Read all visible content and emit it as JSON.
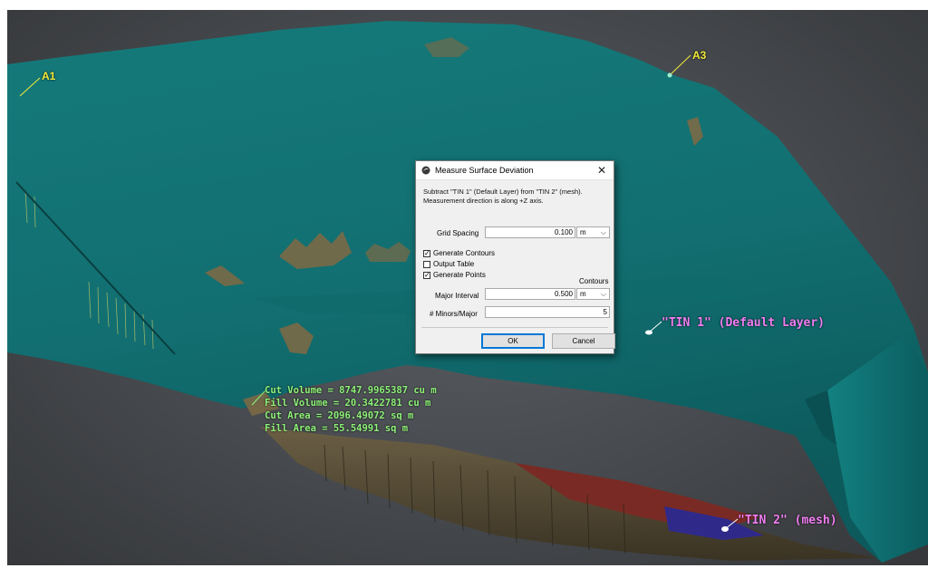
{
  "scene": {
    "markers": [
      {
        "id": "A1",
        "label": "A1"
      },
      {
        "id": "A3",
        "label": "A3"
      }
    ],
    "surfaces": [
      {
        "label": "\"TIN 1\" (Default Layer)"
      },
      {
        "label": "\"TIN 2\" (mesh)"
      }
    ],
    "volumes": {
      "cut_volume": "Cut Volume = 8747.9965387 cu m",
      "fill_volume": "Fill Volume = 20.3422781 cu m",
      "cut_area": "Cut Area = 2096.49072 sq m",
      "fill_area": "Fill Area = 55.54991 sq m"
    },
    "colors": {
      "teal_surface": "#137777",
      "teal_dark": "#0d5a5c",
      "navy_surface": "#0c1257",
      "marker_yellow": "#f2ea3a",
      "label_pink": "#f07ef2",
      "volume_green": "#8ff27a"
    }
  },
  "dialog": {
    "title": "Measure Surface Deviation",
    "icon": "app-icon",
    "close_icon": "close-icon",
    "description_line1": "Subtract \"TIN 1\" (Default Layer) from \"TIN 2\" (mesh).",
    "description_line2": "Measurement direction is along +Z axis.",
    "grid_spacing_label": "Grid Spacing",
    "grid_spacing_value": "0.100",
    "grid_spacing_unit": "m",
    "generate_contours_label": "Generate Contours",
    "generate_contours_checked": true,
    "output_table_label": "Output Table",
    "output_table_checked": false,
    "generate_points_label": "Generate Points",
    "generate_points_checked": true,
    "contours_heading": "Contours",
    "major_interval_label": "Major Interval",
    "major_interval_value": "0.500",
    "major_interval_unit": "m",
    "minors_label": "# Minors/Major",
    "minors_value": "5",
    "ok_label": "OK",
    "cancel_label": "Cancel"
  }
}
